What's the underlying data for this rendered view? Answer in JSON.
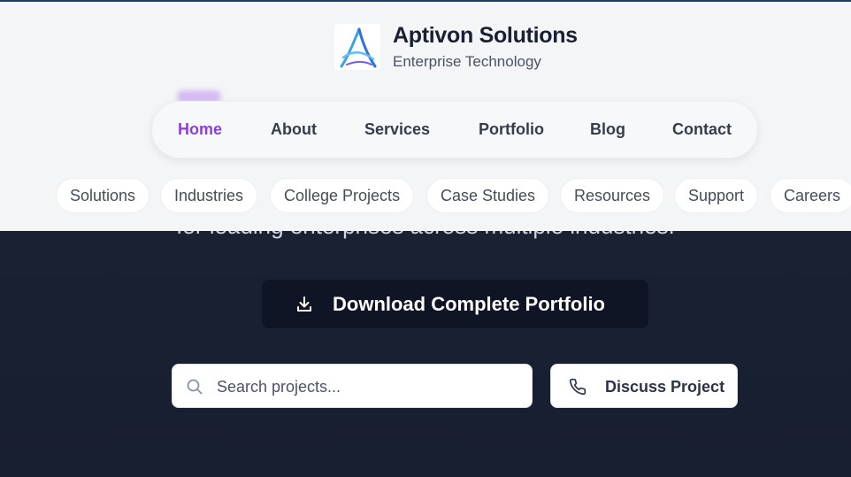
{
  "brand": {
    "name": "Aptivon Solutions",
    "tagline": "Enterprise Technology",
    "logo_icon": "aptivon-logo"
  },
  "nav": {
    "items": [
      {
        "label": "Home",
        "active": true
      },
      {
        "label": "About",
        "active": false
      },
      {
        "label": "Services",
        "active": false
      },
      {
        "label": "Portfolio",
        "active": false
      },
      {
        "label": "Blog",
        "active": false
      },
      {
        "label": "Contact",
        "active": false
      }
    ],
    "active_color": "#8a3fd6"
  },
  "subnav": {
    "items": [
      "Solutions",
      "Industries",
      "College Projects",
      "Case Studies",
      "Resources",
      "Support",
      "Careers"
    ]
  },
  "hero": {
    "partial_text": "for leading enterprises across multiple industries."
  },
  "download": {
    "label": "Download Complete Portfolio",
    "icon": "download-icon"
  },
  "search": {
    "placeholder": "Search projects...",
    "value": "",
    "icon": "search-icon"
  },
  "discuss": {
    "label": "Discuss Project",
    "icon": "phone-icon"
  }
}
